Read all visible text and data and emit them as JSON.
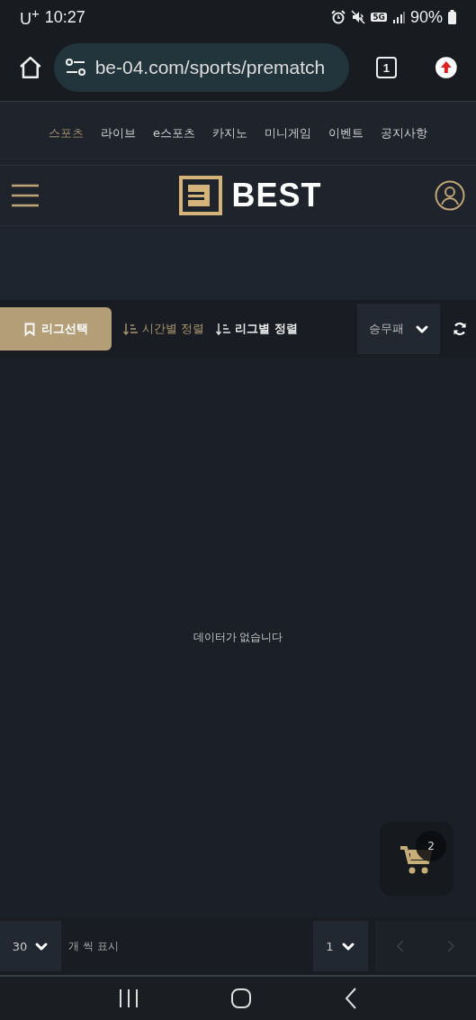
{
  "status_bar": {
    "carrier": "U$^{+}$",
    "time": "10:27",
    "network": "5G",
    "battery": "90%"
  },
  "browser": {
    "url": "be-04.com/sports/prematch",
    "tab_count": "1"
  },
  "nav": [
    {
      "label": "스포츠",
      "selected": true
    },
    {
      "label": "라이브",
      "selected": false
    },
    {
      "label": "e스포츠",
      "selected": false
    },
    {
      "label": "카지노",
      "selected": false
    },
    {
      "label": "미니게임",
      "selected": false
    },
    {
      "label": "이벤트",
      "selected": false
    },
    {
      "label": "공지사항",
      "selected": false
    }
  ],
  "header": {
    "logo": "BEST"
  },
  "toolbar": {
    "league_button": "리그선택",
    "sorts": [
      {
        "label": "시간별 정렬",
        "selected": true
      },
      {
        "label": "리그별 정렬",
        "selected": false
      }
    ],
    "market": "승무패"
  },
  "empty_message": "데이터가 없습니다",
  "cart": {
    "count": "2"
  },
  "pager": {
    "per_page": "30",
    "per_page_label": "개 씩 표시",
    "page": "1",
    "prev_disabled": true,
    "next_disabled": true
  }
}
